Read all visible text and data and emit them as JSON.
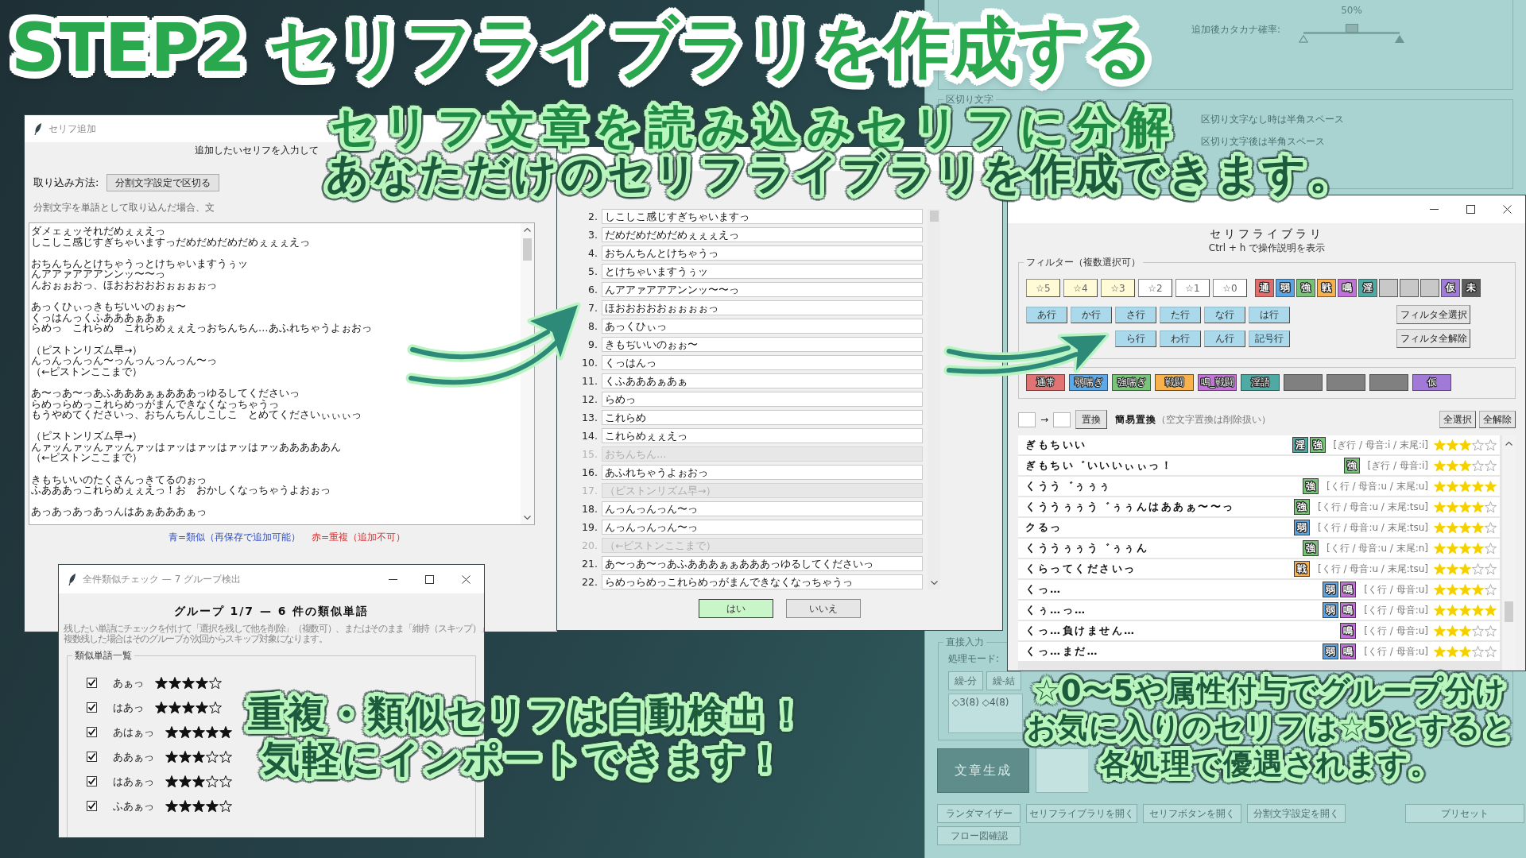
{
  "banner": {
    "title": "STEP2 セリフライブラリを作成する"
  },
  "captions": [
    {
      "lines": [
        "セリフ文章を読み込みセリフに分解",
        "あなただけのセリフライブラリを作成できます。"
      ]
    },
    {
      "lines": [
        "重複・類似セリフは自動検出！",
        "気軽にインポートできます！"
      ]
    },
    {
      "lines": [
        "☆0〜5や属性付与でグループ分け",
        "お気に入りのセリフは☆5とすると",
        "各処理で優遇されます。"
      ]
    }
  ],
  "main_app": {
    "slider": {
      "label": "追加後カタカナ確率:",
      "reading": "50%",
      "level": 0.5
    },
    "delimiter_group": {
      "title": "区切り文字",
      "options": [
        "区切り文字なし時は半角スペース",
        "区切り文字後は半角スペース"
      ]
    },
    "direct_input": {
      "title": "直接入力",
      "mode_label": "処理モード:",
      "buttons": [
        "繰-分",
        "繰-結"
      ],
      "value": "◇3(8) ◇4(8)"
    },
    "generate_button": "文章生成",
    "bottom_buttons": [
      "ランダマイザー",
      "セリフライブラリを開く",
      "セリフボタンを開く",
      "分割文字設定を開く",
      "プリセット",
      "フロー図確認"
    ]
  },
  "add_window": {
    "title": "セリフ追加",
    "heading": "追加したいセリフを入力して",
    "import_label": "取り込み方法:",
    "import_value": "分割文字設定で区切る",
    "hint": "分割文字を単語として取り込んだ場合、文",
    "paragraphs": [
      [
        "ダメェぇッそれだめぇぇえっ",
        "しこしこ感じすぎちゃいますっだめだめだめだめぇぇぇえっ"
      ],
      [
        "おちんちんとけちゃうっとけちゃいますうぅッ",
        "んアアァアアアンンッ〜〜っ",
        "んおぉぉおっ、ほおおおおおぉぉぉぉっ"
      ],
      [
        "あっくひぃっきもぢいいのぉぉ〜",
        "くっはんっくふあああぁあぁ",
        "らめっ　これらめ　これらめぇぇえっおちんちん…あふれちゃうよぉおっ"
      ],
      [
        "（ピストンリズム早→）",
        "んっんっんっん〜っんっんっんっん〜っ",
        "（←ピストンここまで）"
      ],
      [
        "あ〜っあ〜っあふあああぁぁあああっゆるしてくださいっ",
        "らめっらめっこれらめっがまんできなくなっちゃうっ",
        "もうやめてくださいっ、おちんちんしこしこ　とめてくださいぃぃぃっ"
      ],
      [
        "（ピストンリズム早→）",
        "んァッんァッんァッんァッはァッはァッはァッはァッあああああん",
        "（←ピストンここまで）"
      ],
      [
        "きもちいいのたくさんっきてるのぉっ",
        "ふあああっこれらめぇぇえっ！お　おかしくなっちゃうよおぉっ"
      ],
      [
        "あっあっあっあっんはあぁあああぁっ"
      ]
    ],
    "legend": [
      {
        "text": "青=類似（再保存で追加可能）",
        "color": "#2f4fc4"
      },
      {
        "text": "赤=重複（追加不可）",
        "color": "#d23232"
      }
    ]
  },
  "preview_window": {
    "rows": [
      {
        "number": "2.",
        "text": "しこしこ感じすぎちゃいますっ",
        "disabled": false
      },
      {
        "number": "3.",
        "text": "だめだめだめだめぇぇぇえっ",
        "disabled": false
      },
      {
        "number": "4.",
        "text": "おちんちんとけちゃうっ",
        "disabled": false
      },
      {
        "number": "5.",
        "text": "とけちゃいますうぅッ",
        "disabled": false
      },
      {
        "number": "6.",
        "text": "んアアァアアアンンッ〜〜っ",
        "disabled": false
      },
      {
        "number": "7.",
        "text": "ほおおおおおぉぉぉぉっ",
        "disabled": false
      },
      {
        "number": "8.",
        "text": "あっくひぃっ",
        "disabled": false
      },
      {
        "number": "9.",
        "text": "きもぢいいのぉぉ〜",
        "disabled": false
      },
      {
        "number": "10.",
        "text": "くっはんっ",
        "disabled": false
      },
      {
        "number": "11.",
        "text": "くふあああぁあぁ",
        "disabled": false
      },
      {
        "number": "12.",
        "text": "らめっ",
        "disabled": false
      },
      {
        "number": "13.",
        "text": "これらめ",
        "disabled": false
      },
      {
        "number": "14.",
        "text": "これらめぇぇえっ",
        "disabled": false
      },
      {
        "number": "15.",
        "text": "おちんちん…",
        "disabled": true
      },
      {
        "number": "16.",
        "text": "あふれちゃうよぉおっ",
        "disabled": false
      },
      {
        "number": "17.",
        "text": "（ピストンリズム早→）",
        "disabled": true
      },
      {
        "number": "18.",
        "text": "んっんっんっん〜っ",
        "disabled": false
      },
      {
        "number": "19.",
        "text": "んっんっんっん〜っ",
        "disabled": false
      },
      {
        "number": "20.",
        "text": "（←ピストンここまで）",
        "disabled": true
      },
      {
        "number": "21.",
        "text": "あ〜っあ〜っあふあああぁぁあああっゆるしてくださいっ",
        "disabled": false
      },
      {
        "number": "22.",
        "text": "らめっらめっこれらめっがまんできなくなっちゃうっ",
        "disabled": false
      }
    ],
    "buttons": [
      {
        "label": "はい",
        "selected": true
      },
      {
        "label": "いいえ",
        "selected": false
      }
    ]
  },
  "library_window": {
    "heading": "セリフライブラリ",
    "shortcut_hint": "Ctrl + h で操作説明を表示",
    "filter_title": "フィルター（複数選択可）",
    "star_filters": [
      {
        "label": "☆5",
        "selected": true
      },
      {
        "label": "☆4",
        "selected": true
      },
      {
        "label": "☆3",
        "selected": true
      },
      {
        "label": "☆2",
        "selected": false
      },
      {
        "label": "☆1",
        "selected": false
      },
      {
        "label": "☆0",
        "selected": false
      }
    ],
    "attribute_filters": [
      {
        "label": "通",
        "color": "#e06c6c"
      },
      {
        "label": "弱",
        "color": "#5aa4e4"
      },
      {
        "label": "強",
        "color": "#76c276"
      },
      {
        "label": "戦",
        "color": "#f6b04c"
      },
      {
        "label": "鳴",
        "color": "#c070d6"
      },
      {
        "label": "淫",
        "color": "#4fa8a2"
      },
      {
        "color": "#c8c8c8"
      },
      {
        "color": "#c8c8c8"
      },
      {
        "color": "#c8c8c8"
      },
      {
        "label": "仮",
        "color": "#a07cd8"
      },
      {
        "label": "未",
        "color": "#5c5c5c"
      }
    ],
    "kana_filters": [
      [
        "あ行",
        "か行",
        "さ行",
        "た行",
        "な行",
        "は行"
      ],
      [
        "ら行",
        "わ行",
        "ん行",
        "記号行"
      ]
    ],
    "filter_actions": [
      "フィルタ全選択",
      "フィルタ全解除"
    ],
    "tag_bar": [
      {
        "label": "通常",
        "color": "#e07474"
      },
      {
        "label": "弱喘ぎ",
        "color": "#5ea8e6"
      },
      {
        "label": "強喘ぎ",
        "color": "#79c47a"
      },
      {
        "label": "戦闘",
        "color": "#f7b24e"
      },
      {
        "label": "鳴_戦闘",
        "color": "#c274d8"
      },
      {
        "label": "淫語",
        "color": "#4faaa4"
      },
      {
        "color": "#808080"
      },
      {
        "color": "#808080"
      },
      {
        "color": "#808080"
      },
      {
        "label": "仮",
        "color": "#a07ad6"
      }
    ],
    "replace": {
      "arrow": "→",
      "button": "置換",
      "hint": "**簡易置換**（空文字置換は削除扱い）"
    },
    "select_actions": [
      "全選択",
      "全解除"
    ],
    "entries": [
      {
        "text": "ぎもちいい",
        "tags": [
          {
            "label": "淫",
            "color": "#4fa8a2"
          },
          {
            "label": "強",
            "color": "#76c276"
          }
        ],
        "reading": "[ぎ行 / 母音:i / 末尾:i]",
        "stars": 3
      },
      {
        "text": "ぎもちい゛いいいぃぃっ！",
        "tags": [
          {
            "label": "強",
            "color": "#76c276"
          }
        ],
        "reading": "[ぎ行 / 母音:i]",
        "stars": 3
      },
      {
        "text": "くうう゛ぅぅぅ",
        "tags": [
          {
            "label": "強",
            "color": "#76c276"
          }
        ],
        "reading": "[く行 / 母音:u / 末尾:u]",
        "stars": 5
      },
      {
        "text": "くううぅぅう゛ぅぅんはああぁ〜〜っ",
        "tags": [
          {
            "label": "強",
            "color": "#76c276"
          }
        ],
        "reading": "[く行 / 母音:u / 末尾:tsu]",
        "stars": 4
      },
      {
        "text": "クるっ",
        "tags": [
          {
            "label": "弱",
            "color": "#5aa4e4"
          }
        ],
        "reading": "[く行 / 母音:u / 末尾:tsu]",
        "stars": 4
      },
      {
        "text": "くううぅぅう゛ぅぅん",
        "tags": [
          {
            "label": "強",
            "color": "#76c276"
          }
        ],
        "reading": "[く行 / 母音:u / 末尾:n]",
        "stars": 4
      },
      {
        "text": "くらってくださいっ",
        "tags": [
          {
            "label": "戦",
            "color": "#f6b04c"
          }
        ],
        "reading": "[く行 / 母音:u / 末尾:tsu]",
        "stars": 3
      },
      {
        "text": "くっ…",
        "tags": [
          {
            "label": "弱",
            "color": "#5aa4e4"
          },
          {
            "label": "鳴",
            "color": "#c070d6"
          }
        ],
        "reading": "[く行 / 母音:u]",
        "stars": 4
      },
      {
        "text": "くぅ…っ…",
        "tags": [
          {
            "label": "弱",
            "color": "#5aa4e4"
          },
          {
            "label": "鳴",
            "color": "#c070d6"
          }
        ],
        "reading": "[く行 / 母音:u]",
        "stars": 5
      },
      {
        "text": "くっ…負けません…",
        "tags": [
          {
            "label": "鳴",
            "color": "#c070d6"
          }
        ],
        "reading": "[く行 / 母音:u]",
        "stars": 3
      },
      {
        "text": "くっ…まだ…",
        "tags": [
          {
            "label": "弱",
            "color": "#5aa4e4"
          },
          {
            "label": "鳴",
            "color": "#c070d6"
          }
        ],
        "reading": "[く行 / 母音:u]",
        "stars": 3
      }
    ]
  },
  "similar_dialog": {
    "title": "全件類似チェック — 7 グループ検出",
    "heading": "グループ 1/7 — 6 件の類似単語",
    "description": [
      "残したい単語にチェックを付けて「選択を残して他を削除」（複数可）、またはそのまま「維持（スキップ）」",
      "複数残した場合はそのグループが次回からスキップ対象になります。"
    ],
    "list_title": "類似単語一覧",
    "items": [
      {
        "word": "あぁっ",
        "checked": true,
        "stars": 4
      },
      {
        "word": "はあっ",
        "checked": true,
        "stars": 4
      },
      {
        "word": "あはぁっ",
        "checked": true,
        "stars": 5
      },
      {
        "word": "ああぁっ",
        "checked": true,
        "stars": 3
      },
      {
        "word": "はあぁっ",
        "checked": true,
        "stars": 3
      },
      {
        "word": "ふあぁっ",
        "checked": true,
        "stars": 4
      }
    ]
  }
}
